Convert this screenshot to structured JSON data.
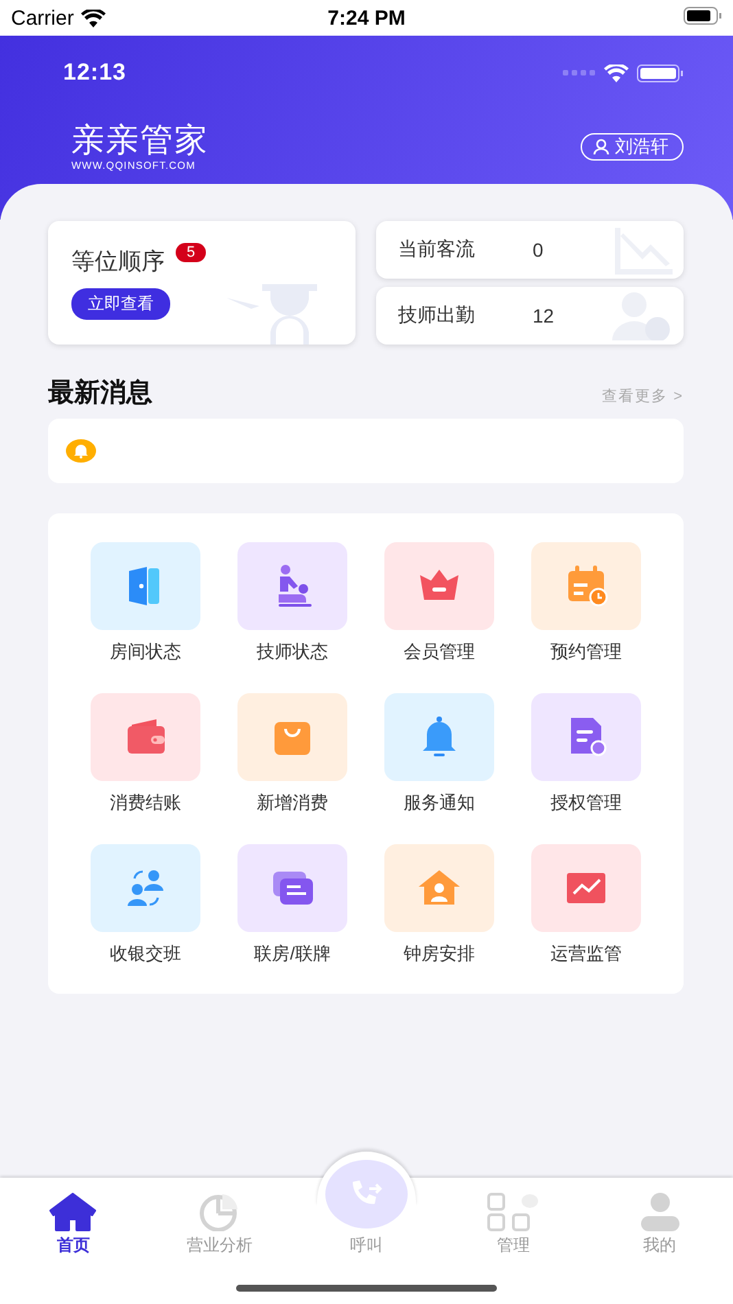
{
  "ios_status": {
    "carrier": "Carrier",
    "time": "7:24 PM"
  },
  "app_status": {
    "time": "12:13"
  },
  "header": {
    "logo": "亲亲管家",
    "logo_url": "WWW.QQINSOFT.COM",
    "user": "刘浩轩"
  },
  "queue_card": {
    "title": "等位顺序",
    "badge": "5",
    "button": "立即查看"
  },
  "stats": [
    {
      "label": "当前客流",
      "value": "0",
      "kind": "flow"
    },
    {
      "label": "技师出勤",
      "value": "12",
      "kind": "staff"
    }
  ],
  "news": {
    "title": "最新消息",
    "more": "查看更多 >"
  },
  "functions": [
    {
      "label": "房间状态",
      "kind": "door",
      "color": "#e1f3ff"
    },
    {
      "label": "技师状态",
      "kind": "massage",
      "color": "#efe6ff"
    },
    {
      "label": "会员管理",
      "kind": "crown",
      "color": "#ffe6e8"
    },
    {
      "label": "预约管理",
      "kind": "calendar",
      "color": "#ffefe0"
    },
    {
      "label": "消费结账",
      "kind": "wallet",
      "color": "#ffe6e8"
    },
    {
      "label": "新增消费",
      "kind": "bag",
      "color": "#ffefe0"
    },
    {
      "label": "服务通知",
      "kind": "bell",
      "color": "#e1f3ff"
    },
    {
      "label": "授权管理",
      "kind": "certificate",
      "color": "#efe6ff"
    },
    {
      "label": "收银交班",
      "kind": "swap",
      "color": "#e1f3ff"
    },
    {
      "label": "联房/联牌",
      "kind": "cards",
      "color": "#efe6ff"
    },
    {
      "label": "钟房安排",
      "kind": "house",
      "color": "#ffefe0"
    },
    {
      "label": "运营监管",
      "kind": "chart",
      "color": "#ffe6e8"
    }
  ],
  "tabs": [
    {
      "label": "首页",
      "kind": "home",
      "selected": true
    },
    {
      "label": "营业分析",
      "kind": "pie",
      "selected": false
    },
    {
      "label": "呼叫",
      "kind": "call",
      "selected": false
    },
    {
      "label": "管理",
      "kind": "apps",
      "selected": false
    },
    {
      "label": "我的",
      "kind": "person",
      "selected": false
    }
  ]
}
